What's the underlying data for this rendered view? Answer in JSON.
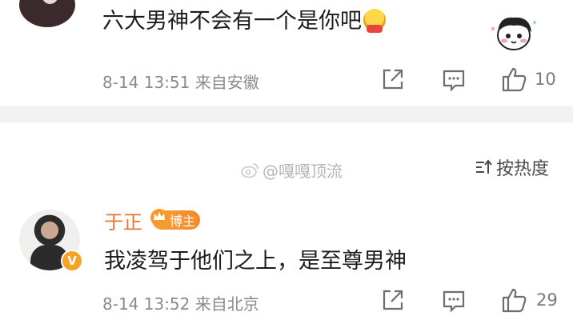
{
  "comments": [
    {
      "text": "六大男神不会有一个是你吧",
      "meta": "8-14 13:51 来自安徽",
      "like_count": "10"
    },
    {
      "author": "于正",
      "badge": "博主",
      "verified_mark": "V",
      "text": "我凌驾于他们之上，是至尊男神",
      "meta": "8-14 13:52 来自北京",
      "like_count": "29"
    }
  ],
  "watermark": "@嘎嘎顶流",
  "sort_label": "按热度",
  "icons": [
    "share-icon",
    "comment-icon",
    "like-icon",
    "sort-icon",
    "weibo-logo-icon"
  ],
  "colors": {
    "author": "#e8772e",
    "badge": "#f38a28",
    "meta": "#8a8a8a",
    "divider": "#f2f2f2"
  }
}
